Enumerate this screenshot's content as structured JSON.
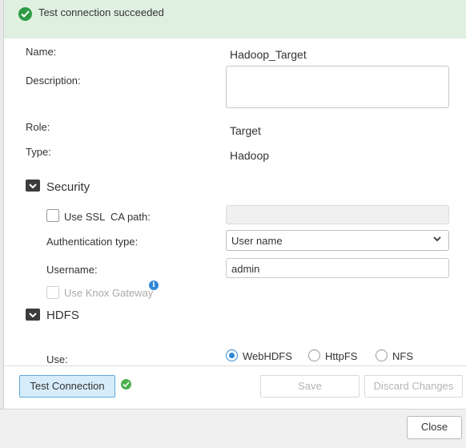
{
  "banner": {
    "message": "Test connection succeeded",
    "icon": "check-circle-icon",
    "color": "#2e9b45",
    "bg": "#dff0e1"
  },
  "form": {
    "name_label": "Name:",
    "name_value": "Hadoop_Target",
    "description_label": "Description:",
    "description_value": "",
    "role_label": "Role:",
    "role_value": "Target",
    "type_label": "Type:",
    "type_value": "Hadoop"
  },
  "security": {
    "title": "Security",
    "use_ssl_label": "Use SSL",
    "use_ssl_checked": false,
    "ca_path_label": "CA path:",
    "ca_path_value": "",
    "auth_type_label": "Authentication type:",
    "auth_type_value": "User name",
    "username_label": "Username:",
    "username_value": "admin",
    "use_knox_label": "Use Knox Gateway",
    "use_knox_checked": false
  },
  "hdfs": {
    "title": "HDFS",
    "use_label": "Use:",
    "options": [
      "WebHDFS",
      "HttpFS",
      "NFS"
    ],
    "selected": "WebHDFS"
  },
  "footer": {
    "test_connection": "Test Connection",
    "save": "Save",
    "discard": "Discard Changes",
    "close": "Close"
  },
  "colors": {
    "accent": "#2e87d6",
    "primary_button_bg": "#d7ecfa"
  }
}
